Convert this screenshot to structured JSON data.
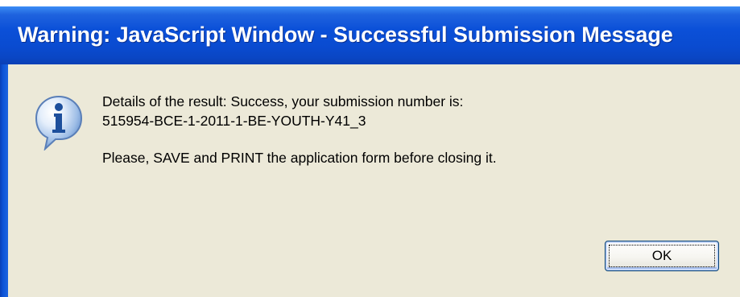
{
  "window": {
    "title": "Warning: JavaScript Window - Successful Submission Message",
    "colors": {
      "titlebar": "#0b50d8",
      "body": "#ece9d8",
      "title_text": "#ffffff"
    }
  },
  "dialog": {
    "icon": "info-icon",
    "message_line_1": "Details of the result: Success, your submission number is:",
    "message_line_2": "515954-BCE-1-2011-1-BE-YOUTH-Y41_3",
    "message_line_3": "Please, SAVE and PRINT the application form before closing it.",
    "ok_label": "OK"
  }
}
